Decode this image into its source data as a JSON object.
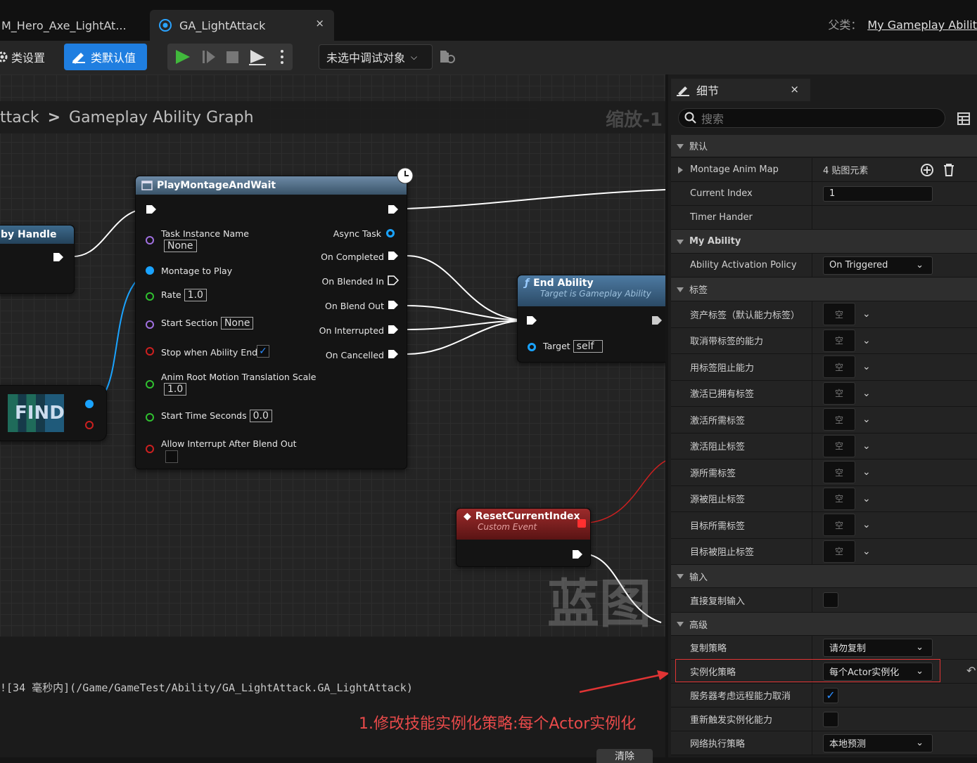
{
  "window": {
    "tabs": [
      {
        "label": "M_Hero_Axe_LightAt..."
      },
      {
        "label": "GA_LightAttack",
        "close": "×"
      }
    ],
    "parent_class_prefix": "父类：",
    "parent_class_link": "My Gameplay Abilit"
  },
  "toolbar": {
    "class_settings": "类设置",
    "class_defaults": "类默认值",
    "debug_target": "未选中调试对象"
  },
  "graph": {
    "breadcrumb_parent": "ttack",
    "breadcrumb_separator": ">",
    "breadcrumb_current": "Gameplay Ability Graph",
    "zoom": "缩放-1",
    "watermark": "蓝图",
    "nodes": {
      "handle": {
        "title": "by Handle"
      },
      "find": {
        "title": "FIND"
      },
      "play_montage": {
        "title": "PlayMontageAndWait",
        "inputs": {
          "task_instance_name": "Task Instance Name",
          "task_instance_value": "None",
          "montage_to_play": "Montage to Play",
          "rate": "Rate",
          "rate_value": "1.0",
          "start_section": "Start Section",
          "start_section_value": "None",
          "stop_when_ability_ends": "Stop when Ability Ends",
          "anim_root_motion": "Anim Root Motion Translation Scale",
          "anim_root_motion_value": "1.0",
          "start_time_seconds": "Start Time Seconds",
          "start_time_value": "0.0",
          "allow_interrupt": "Allow Interrupt After Blend Out"
        },
        "outputs": {
          "async_task": "Async Task",
          "on_completed": "On Completed",
          "on_blended_in": "On Blended In",
          "on_blend_out": "On Blend Out",
          "on_interrupted": "On Interrupted",
          "on_cancelled": "On Cancelled"
        }
      },
      "end_ability": {
        "title": "End Ability",
        "subtitle": "Target is Gameplay Ability",
        "target_label": "Target",
        "target_value": "self"
      },
      "reset_index": {
        "title": "ResetCurrentIndex",
        "subtitle": "Custom Event"
      }
    }
  },
  "log": {
    "line": "![34 毫秒内](/Game/GameTest/Ability/GA_LightAttack.GA_LightAttack)",
    "annotation": "1.修改技能实例化策略:每个Actor实例化",
    "clear": "清除"
  },
  "details": {
    "tab": "细节",
    "tab_close": "×",
    "search_placeholder": "搜索",
    "categories": {
      "default": "默认",
      "my_ability": "My Ability",
      "tags": "标签",
      "input": "输入",
      "advanced": "高级"
    },
    "props": {
      "montage_anim_map": {
        "name": "Montage Anim Map",
        "value": "4 贴图元素"
      },
      "current_index": {
        "name": "Current Index",
        "value": "1"
      },
      "timer_hander": {
        "name": "Timer Hander"
      },
      "activation_policy": {
        "name": "Ability Activation Policy",
        "value": "On Triggered"
      },
      "tag_rows": [
        {
          "name": "资产标签（默认能力标签）",
          "value": "空"
        },
        {
          "name": "取消带标签的能力",
          "value": "空"
        },
        {
          "name": "用标签阻止能力",
          "value": "空"
        },
        {
          "name": "激活已拥有标签",
          "value": "空"
        },
        {
          "name": "激活所需标签",
          "value": "空"
        },
        {
          "name": "激活阻止标签",
          "value": "空"
        },
        {
          "name": "源所需标签",
          "value": "空"
        },
        {
          "name": "源被阻止标签",
          "value": "空"
        },
        {
          "name": "目标所需标签",
          "value": "空"
        },
        {
          "name": "目标被阻止标签",
          "value": "空"
        }
      ],
      "direct_input": {
        "name": "直接复制输入",
        "checked": false
      },
      "replication_policy": {
        "name": "复制策略",
        "value": "请勿复制"
      },
      "instancing_policy": {
        "name": "实例化策略",
        "value": "每个Actor实例化"
      },
      "server_respects_cancel": {
        "name": "服务器考虑远程能力取消",
        "checked": true
      },
      "retrigger": {
        "name": "重新触发实例化能力",
        "checked": false
      },
      "net_execution": {
        "name": "网络执行策略",
        "value": "本地预测"
      }
    }
  },
  "colors": {
    "accent": "#1f7ee0",
    "annotation_red": "#e03434",
    "pin_blue": "#1aa3ff",
    "pin_green": "#30c030",
    "pin_purple": "#a070e0",
    "pin_red": "#cc2020"
  }
}
